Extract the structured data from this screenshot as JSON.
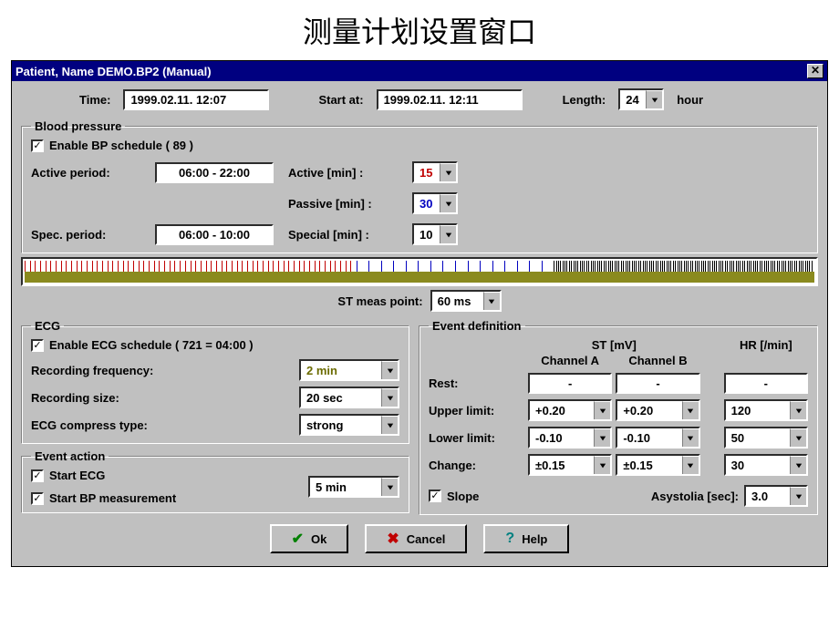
{
  "page_heading": "测量计划设置窗口",
  "window_title": "Patient, Name DEMO.BP2 (Manual)",
  "header": {
    "time_label": "Time:",
    "time_value": "1999.02.11. 12:07",
    "start_label": "Start at:",
    "start_value": "1999.02.11. 12:11",
    "length_label": "Length:",
    "length_value": "24",
    "length_unit": "hour"
  },
  "bp": {
    "legend": "Blood pressure",
    "enable_label": "Enable BP schedule  ( 89 )",
    "enable_checked": true,
    "active_period_label": "Active period:",
    "active_period_value": "06:00 - 22:00",
    "active_min_label": "Active [min] :",
    "active_min_value": "15",
    "passive_min_label": "Passive [min] :",
    "passive_min_value": "30",
    "spec_period_label": "Spec. period:",
    "spec_period_value": "06:00 - 10:00",
    "special_min_label": "Special [min] :",
    "special_min_value": "10"
  },
  "st_meas": {
    "label": "ST meas point:",
    "value": "60 ms"
  },
  "ecg": {
    "legend": "ECG",
    "enable_label": "Enable ECG schedule  ( 721 = 04:00 )",
    "enable_checked": true,
    "rec_freq_label": "Recording frequency:",
    "rec_freq_value": "2 min",
    "rec_size_label": "Recording size:",
    "rec_size_value": "20 sec",
    "compress_label": "ECG compress type:",
    "compress_value": "strong"
  },
  "event_action": {
    "legend": "Event action",
    "start_ecg_label": "Start ECG",
    "start_ecg_checked": true,
    "start_bp_label": "Start BP measurement",
    "start_bp_checked": true,
    "duration_value": "5  min"
  },
  "event_def": {
    "legend": "Event definition",
    "st_header": "ST [mV]",
    "ch_a": "Channel A",
    "ch_b": "Channel B",
    "hr_header": "HR [/min]",
    "rest_label": "Rest:",
    "rest_a": "-",
    "rest_b": "-",
    "rest_hr": "-",
    "upper_label": "Upper limit:",
    "upper_a": "+0.20",
    "upper_b": "+0.20",
    "upper_hr": "120",
    "lower_label": "Lower limit:",
    "lower_a": "-0.10",
    "lower_b": "-0.10",
    "lower_hr": "50",
    "change_label": "Change:",
    "change_a": "±0.15",
    "change_b": "±0.15",
    "change_hr": "30",
    "slope_label": "Slope",
    "slope_checked": true,
    "asystolia_label": "Asystolia [sec]:",
    "asystolia_value": "3.0"
  },
  "buttons": {
    "ok": "Ok",
    "cancel": "Cancel",
    "help": "Help"
  },
  "icons": {
    "check": "✓",
    "close": "✕"
  }
}
